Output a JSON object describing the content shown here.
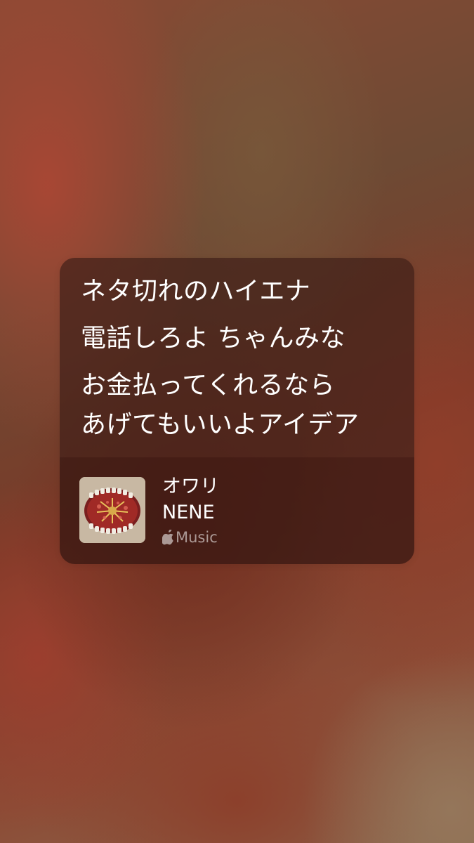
{
  "lyrics": {
    "lines": [
      "ネタ切れのハイエナ",
      "電話しろよ ちゃんみな",
      "お金払ってくれるなら",
      "あげてもいいよアイデア"
    ]
  },
  "track": {
    "title": "オワリ",
    "artist": "NENE",
    "service_label": "Music",
    "service_icon": "apple-logo-icon",
    "artwork_icon": "album-artwork"
  },
  "colors": {
    "text_primary": "#ffffff",
    "text_secondary": "rgba(255,255,255,0.55)",
    "card_background": "rgba(60,28,22,0.55)"
  }
}
